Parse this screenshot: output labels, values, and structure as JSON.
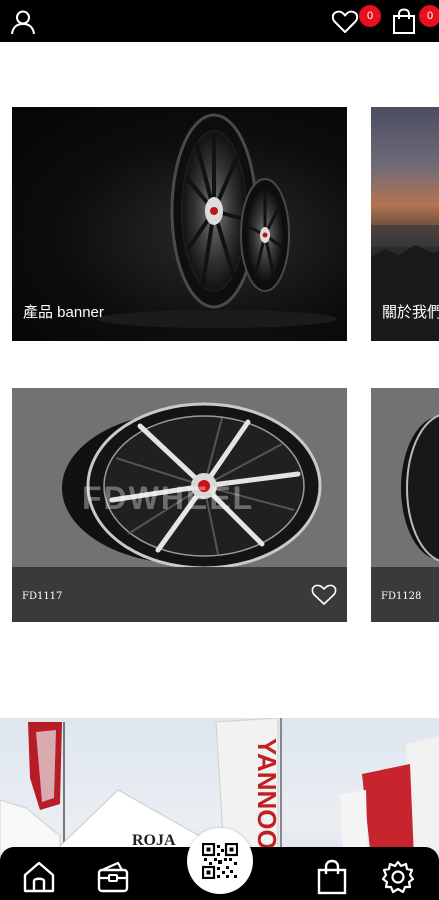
{
  "header": {
    "wishlist_count": "0",
    "cart_count": "0",
    "icons": [
      "user-icon",
      "heart-icon",
      "shopping-bag-icon"
    ]
  },
  "banners": [
    {
      "caption": "產品 banner"
    },
    {
      "caption": "關於我們"
    }
  ],
  "products": [
    {
      "code": "FD1117",
      "watermark": "FDWHEEL"
    },
    {
      "code": "FD1128"
    }
  ],
  "photo_section": {
    "flags": [
      "ROJA",
      "YANNOO"
    ]
  },
  "bottom_nav": {
    "items": [
      "home-icon",
      "wallet-icon",
      "qr-code-icon",
      "shopping-bag-icon",
      "settings-gear-icon"
    ]
  },
  "colors": {
    "bar_background": "#000000",
    "badge": "#e8101d",
    "card_grey": "#727272"
  }
}
